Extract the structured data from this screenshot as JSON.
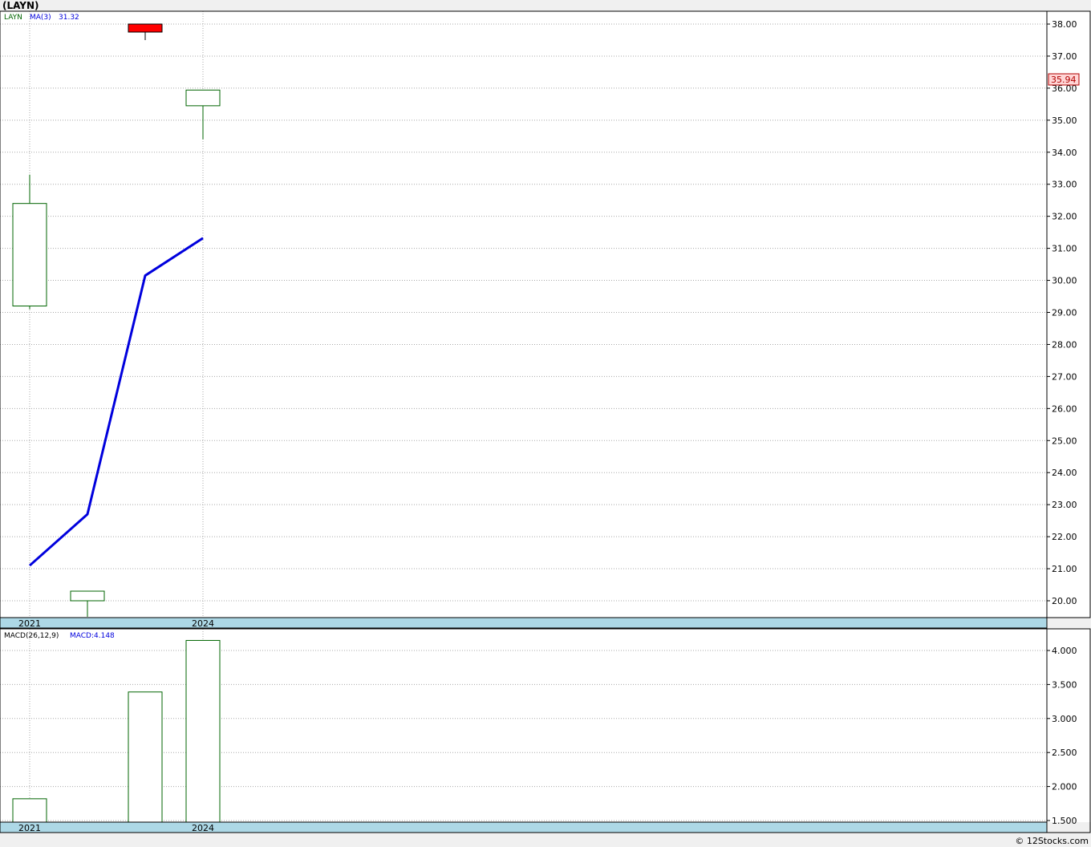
{
  "title": "(LAYN)",
  "copyright": "© 12Stocks.com",
  "colors": {
    "up": "#006400",
    "down_fill": "#ff0000",
    "ma": "#0000dd",
    "time_bar": "#add8e6",
    "last_price_bg": "#ffd6d6",
    "last_price_text": "#b00000"
  },
  "chart_data": [
    {
      "type": "candlestick",
      "name": "price",
      "legend": {
        "symbol": "LAYN",
        "ma_label": "MA(3)",
        "ma_value": "31.32"
      },
      "last_price": "35.94",
      "ylim": [
        19.5,
        38.4
      ],
      "ticks": [
        "20.00",
        "21.00",
        "22.00",
        "23.00",
        "24.00",
        "25.00",
        "26.00",
        "27.00",
        "28.00",
        "29.00",
        "30.00",
        "31.00",
        "32.00",
        "33.00",
        "34.00",
        "35.00",
        "36.00",
        "37.00",
        "38.00"
      ],
      "x_labels": [
        {
          "label": "2021",
          "index": 0
        },
        {
          "label": "2024",
          "index": 3
        }
      ],
      "candles": [
        {
          "open": 29.2,
          "high": 33.3,
          "low": 29.1,
          "close": 32.4,
          "direction": "up"
        },
        {
          "open": 20.0,
          "high": 20.3,
          "low": 19.5,
          "close": 20.3,
          "direction": "up"
        },
        {
          "open": 38.0,
          "high": 38.0,
          "low": 37.5,
          "close": 37.75,
          "direction": "down"
        },
        {
          "open": 35.45,
          "high": 35.94,
          "low": 34.4,
          "close": 35.94,
          "direction": "up"
        }
      ],
      "ma3": [
        21.1,
        22.7,
        30.15,
        31.32
      ]
    },
    {
      "type": "bar",
      "name": "macd",
      "legend": {
        "label": "MACD(26,12,9)",
        "value_label": "MACD:4.148"
      },
      "ylim": [
        1.49,
        4.22
      ],
      "ticks": [
        "1.500",
        "2.000",
        "2.500",
        "3.000",
        "3.500",
        "4.000"
      ],
      "x_labels": [
        {
          "label": "2021",
          "index": 0
        },
        {
          "label": "2024",
          "index": 3
        }
      ],
      "values": [
        1.82,
        null,
        3.39,
        4.148
      ]
    }
  ]
}
